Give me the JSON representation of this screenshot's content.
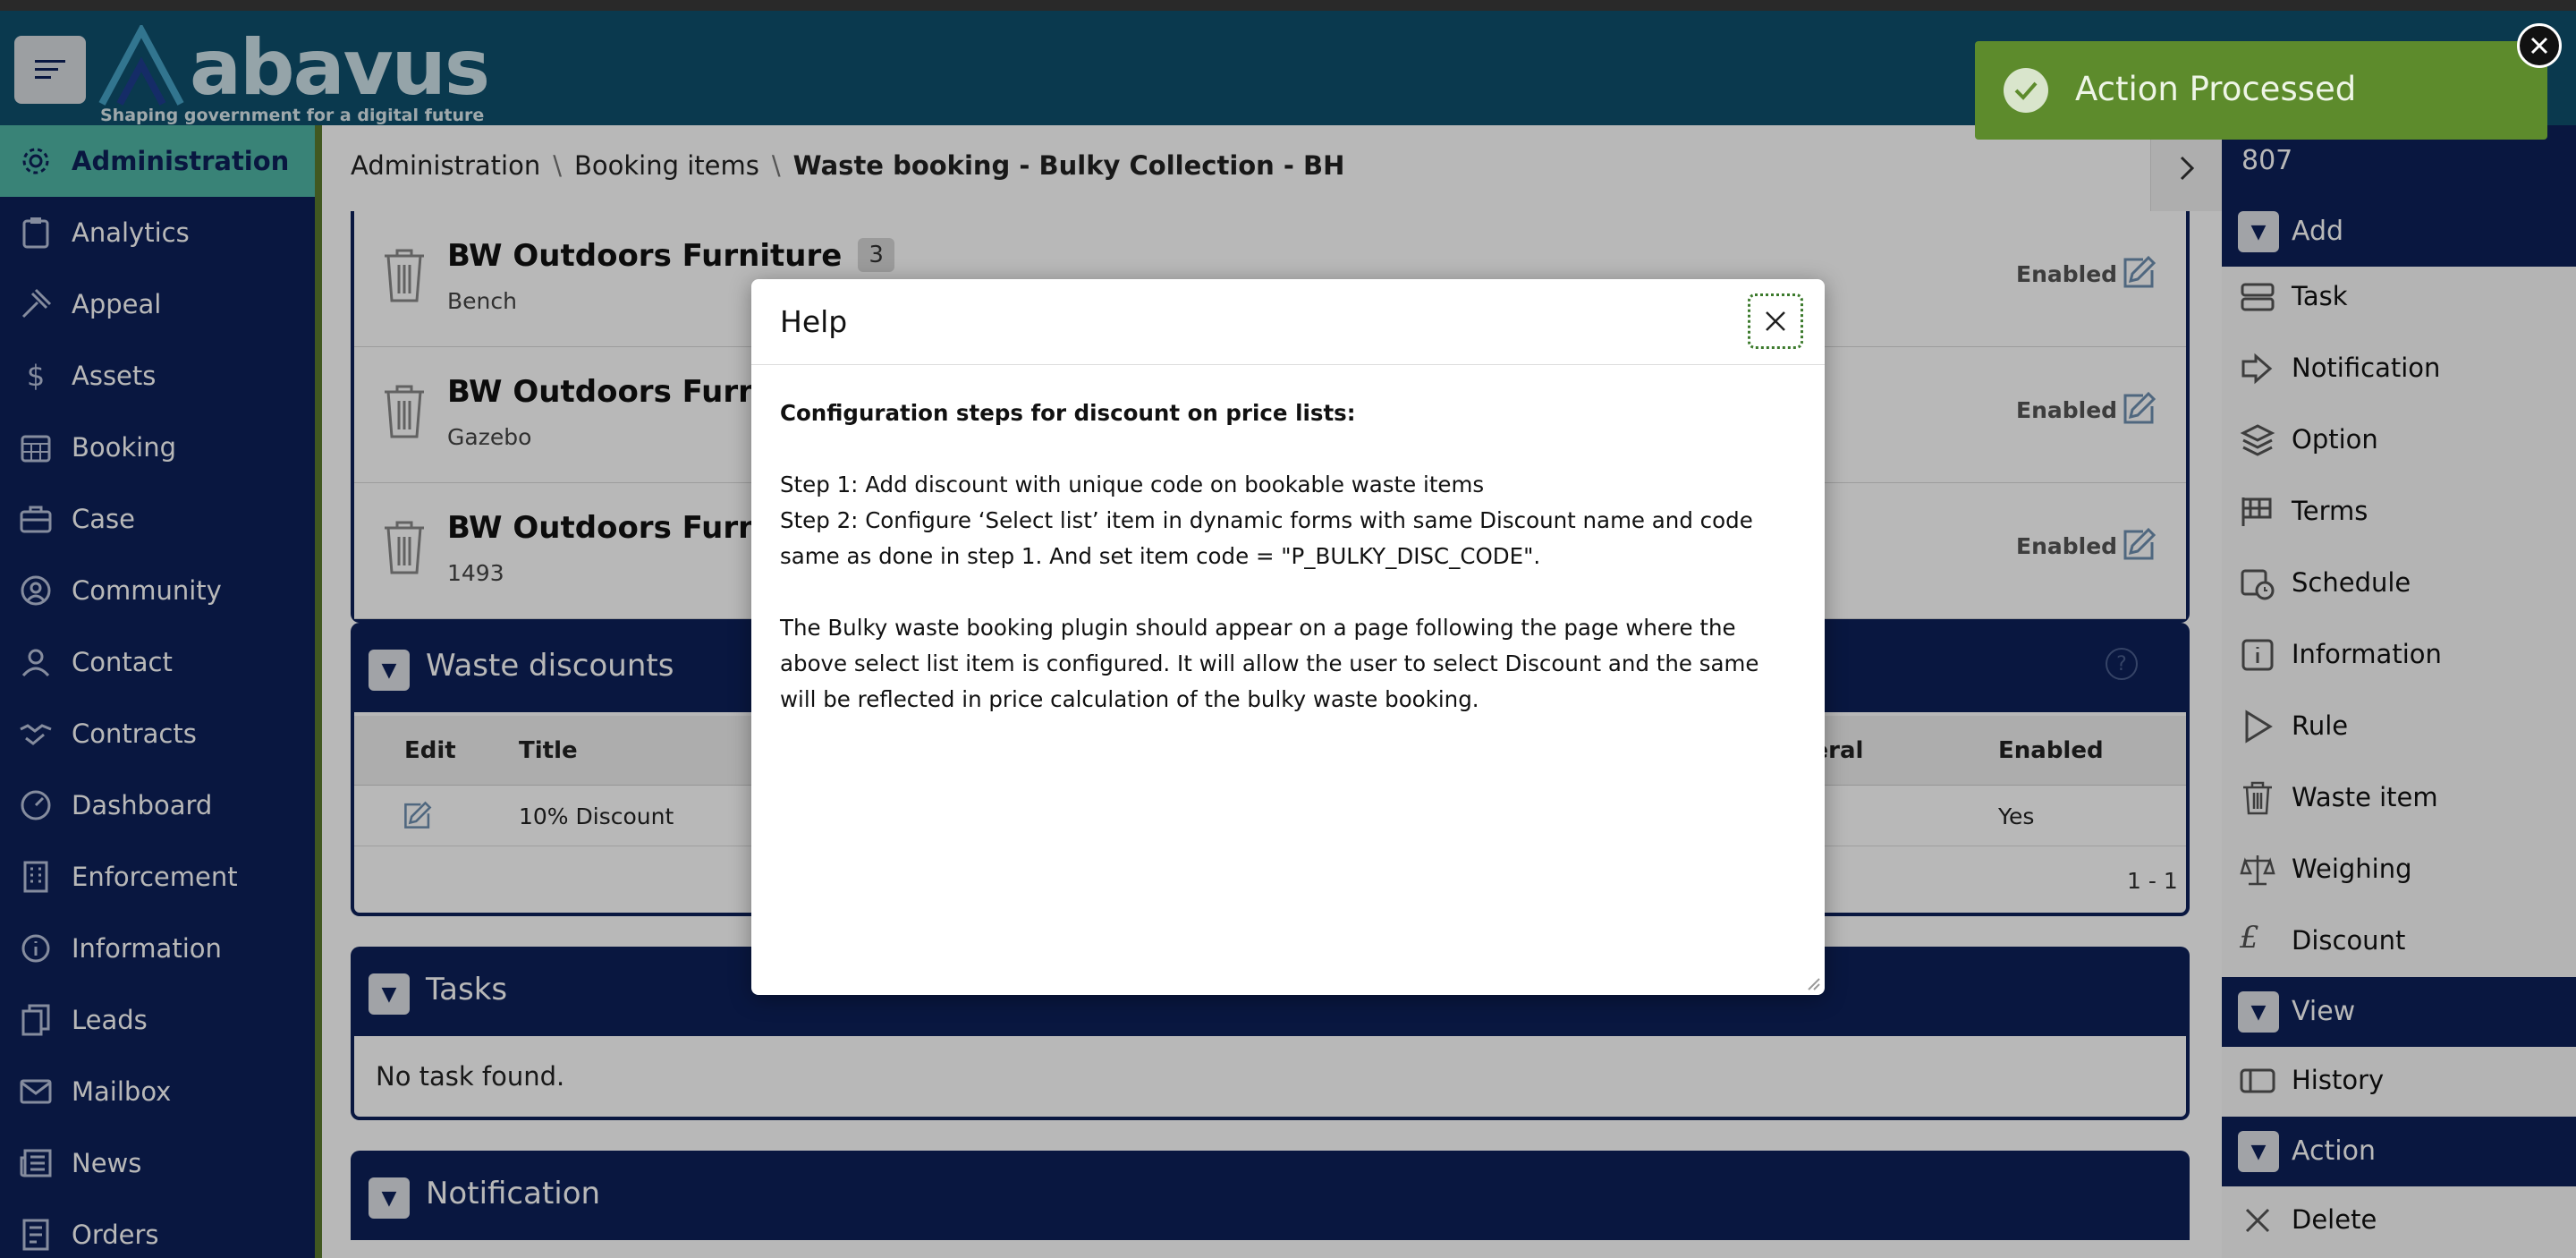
{
  "header": {
    "logo_text": "abavus",
    "logo_tagline": "Shaping government for a digital future"
  },
  "sidebar": {
    "items": [
      {
        "label": "Administration",
        "icon": "gear-icon",
        "active": true
      },
      {
        "label": "Analytics",
        "icon": "clipboard-icon"
      },
      {
        "label": "Appeal",
        "icon": "gavel-icon"
      },
      {
        "label": "Assets",
        "icon": "dollar-icon"
      },
      {
        "label": "Booking",
        "icon": "calendar-icon"
      },
      {
        "label": "Case",
        "icon": "briefcase-icon"
      },
      {
        "label": "Community",
        "icon": "people-icon"
      },
      {
        "label": "Contact",
        "icon": "person-icon"
      },
      {
        "label": "Contracts",
        "icon": "handshake-icon"
      },
      {
        "label": "Dashboard",
        "icon": "gauge-icon"
      },
      {
        "label": "Enforcement",
        "icon": "building-icon"
      },
      {
        "label": "Information",
        "icon": "info-icon"
      },
      {
        "label": "Leads",
        "icon": "copy-icon"
      },
      {
        "label": "Mailbox",
        "icon": "envelope-icon"
      },
      {
        "label": "News",
        "icon": "newspaper-icon"
      },
      {
        "label": "Orders",
        "icon": "cart-icon"
      }
    ]
  },
  "breadcrumb": {
    "items": [
      "Administration",
      "Booking items"
    ],
    "current": "Waste booking - Bulky Collection - BH",
    "separator": "\\"
  },
  "waste_items": [
    {
      "title": "BW Outdoors Furniture",
      "count": "3",
      "sub": "Bench",
      "status": "Enabled"
    },
    {
      "title": "BW Outdoors Furniture",
      "count": "",
      "sub": "Gazebo",
      "status": "Enabled"
    },
    {
      "title": "BW Outdoors Furniture",
      "count": "",
      "sub": "1493",
      "status": "Enabled"
    }
  ],
  "waste_discounts": {
    "title": "Waste discounts",
    "columns": [
      "Edit",
      "Title",
      "neral",
      "Enabled"
    ],
    "rows": [
      {
        "title": "10% Discount",
        "enabled": "Yes"
      }
    ],
    "pager": "1 - 1"
  },
  "tasks": {
    "title": "Tasks",
    "empty_text": "No task found."
  },
  "notification": {
    "title": "Notification"
  },
  "right_panel": {
    "id": "807",
    "add_title": "Add",
    "add_items": [
      {
        "label": "Task",
        "icon": "task-icon"
      },
      {
        "label": "Notification",
        "icon": "notification-icon"
      },
      {
        "label": "Option",
        "icon": "layers-icon"
      },
      {
        "label": "Terms",
        "icon": "terms-icon"
      },
      {
        "label": "Schedule",
        "icon": "schedule-icon"
      },
      {
        "label": "Information",
        "icon": "info-icon"
      },
      {
        "label": "Rule",
        "icon": "play-icon"
      },
      {
        "label": "Waste item",
        "icon": "trash-icon"
      },
      {
        "label": "Weighing",
        "icon": "scale-icon"
      },
      {
        "label": "Discount",
        "icon": "pound-icon"
      }
    ],
    "view_title": "View",
    "view_items": [
      {
        "label": "History",
        "icon": "history-icon"
      }
    ],
    "action_title": "Action",
    "action_items": [
      {
        "label": "Delete",
        "icon": "close-icon"
      }
    ]
  },
  "modal": {
    "title": "Help",
    "heading": "Configuration steps for discount on price lists:",
    "step1": "Step 1: Add discount with unique code on bookable waste items",
    "step2": "Step 2: Configure ‘Select list’ item in dynamic forms with same Discount name and code same as done in step 1. And set item code = \"P_BULKY_DISC_CODE\".",
    "para": "The Bulky waste booking plugin should appear on a page following the page where the above select list item is configured. It will allow the user to select Discount and the same will be reflected in price calculation of the bulky waste booking."
  },
  "toast": {
    "message": "Action Processed"
  },
  "colors": {
    "navy": "#0d2159",
    "header": "#0e4f6c",
    "active": "#4fb6a6",
    "toast": "#5d8b2c"
  }
}
